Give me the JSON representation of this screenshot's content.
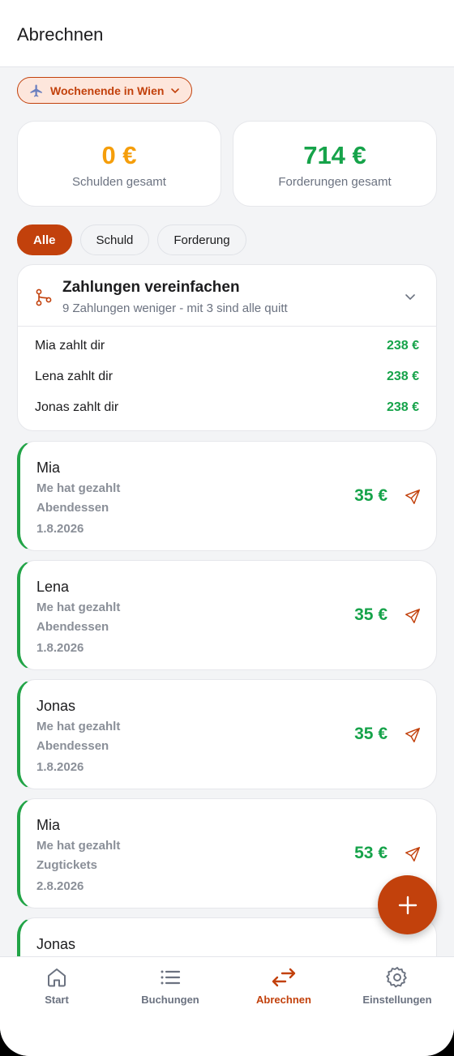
{
  "header": {
    "title": "Abrechnen"
  },
  "trip": {
    "label": "Wochenende in Wien"
  },
  "stats": {
    "debts": {
      "value": "0 €",
      "caption": "Schulden gesamt",
      "color": "#f59e0b"
    },
    "claims": {
      "value": "714 €",
      "caption": "Forderungen gesamt",
      "color": "#16a34a"
    }
  },
  "filters": [
    "Alle",
    "Schuld",
    "Forderung"
  ],
  "simplify": {
    "title": "Zahlungen vereinfachen",
    "subtitle": "9 Zahlungen weniger - mit 3 sind alle quitt",
    "rows": [
      {
        "label": "Mia zahlt dir",
        "amount": "238 €"
      },
      {
        "label": "Lena zahlt dir",
        "amount": "238 €"
      },
      {
        "label": "Jonas zahlt dir",
        "amount": "238 €"
      }
    ]
  },
  "entries": [
    {
      "name": "Mia",
      "payer": "Me hat gezahlt",
      "item": "Abendessen",
      "date": "1.8.2026",
      "amount": "35 €"
    },
    {
      "name": "Lena",
      "payer": "Me hat gezahlt",
      "item": "Abendessen",
      "date": "1.8.2026",
      "amount": "35 €"
    },
    {
      "name": "Jonas",
      "payer": "Me hat gezahlt",
      "item": "Abendessen",
      "date": "1.8.2026",
      "amount": "35 €"
    },
    {
      "name": "Mia",
      "payer": "Me hat gezahlt",
      "item": "Zugtickets",
      "date": "2.8.2026",
      "amount": "53 €"
    },
    {
      "name": "Jonas"
    }
  ],
  "tabs": [
    {
      "label": "Start",
      "icon": "home-icon"
    },
    {
      "label": "Buchungen",
      "icon": "list-icon"
    },
    {
      "label": "Abrechnen",
      "icon": "swap-icon",
      "active": true
    },
    {
      "label": "Einstellungen",
      "icon": "gear-icon"
    }
  ],
  "colors": {
    "accent": "#c2410c",
    "positive": "#16a34a",
    "warning": "#f59e0b"
  }
}
